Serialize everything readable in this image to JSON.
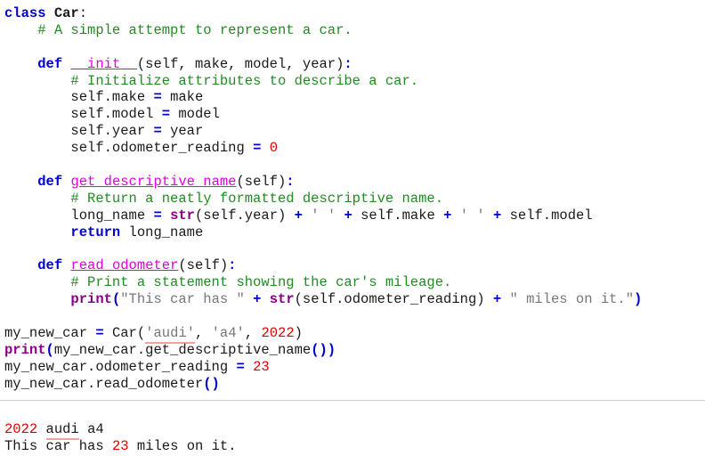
{
  "colors": {
    "keyword": "#0000cc",
    "builtin": "#8b008b",
    "function_name": "#e000e0",
    "comment": "#228b22",
    "number": "#e00000",
    "string": "#777777",
    "spell_underline": "#f2a0a0"
  },
  "code": {
    "line1": {
      "kw": "class",
      "name": "Car",
      "colon": ":"
    },
    "line2": {
      "comment": "# A simple attempt to represent a car."
    },
    "line4": {
      "kw": "def",
      "fn": "__init__",
      "rest": "(self, make, model, year)",
      "colon": ":"
    },
    "line5": {
      "comment": "# Initialize attributes to describe a car."
    },
    "line6": {
      "a": "self.make",
      "op": "=",
      "b": "make"
    },
    "line7": {
      "a": "self.model",
      "op": "=",
      "b": "model"
    },
    "line8": {
      "a": "self.year",
      "op": "=",
      "b": "year"
    },
    "line9": {
      "a": "self.odometer_reading",
      "op": "=",
      "num": "0"
    },
    "line11": {
      "kw": "def",
      "fn": "get_descriptive_name",
      "rest": "(self)",
      "colon": ":"
    },
    "line12": {
      "comment": "# Return a neatly formatted descriptive name."
    },
    "line13": {
      "a": "long_name",
      "op": "=",
      "builtin": "str",
      "arg": "(self.year)",
      "plus": "+",
      "space_str": "' '",
      "make": "self.make",
      "model": "self.model"
    },
    "line14": {
      "kw": "return",
      "b": "long_name"
    },
    "line16": {
      "kw": "def",
      "fn": "read_odometer",
      "rest": "(self)",
      "colon": ":"
    },
    "line17": {
      "comment": "# Print a statement showing the car's mileage."
    },
    "line18": {
      "builtin": "print",
      "open": "(",
      "str1": "\"This car has \"",
      "plus": "+",
      "builtin2": "str",
      "arg": "(self.odometer_reading)",
      "str2": "\" miles on it.\"",
      "close": ")"
    },
    "line20": {
      "a": "my_new_car",
      "op": "=",
      "call": "Car(",
      "str_audi": "'audi'",
      "comma": ",",
      "str_a4": "'a4'",
      "num": "2022",
      "close": ")"
    },
    "line21": {
      "builtin": "print",
      "open": "(",
      "call": "my_new_car.get_descriptive_name",
      "parens": "()",
      "close": ")"
    },
    "line22": {
      "a": "my_new_car.odometer_reading",
      "op": "=",
      "num": "23"
    },
    "line23": {
      "call": "my_new_car.read_odometer",
      "parens": "()"
    }
  },
  "output": {
    "line1": {
      "year": "2022",
      "make": "audi",
      "model": "a4"
    },
    "line2": {
      "pre": "This",
      "car": "car",
      "mid": "has",
      "num": "23",
      "post": "miles on it."
    }
  }
}
